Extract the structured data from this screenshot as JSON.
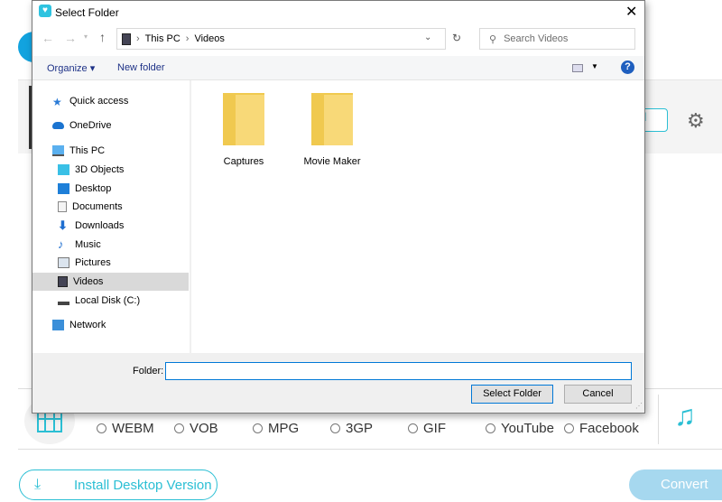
{
  "dialog": {
    "title": "Select Folder",
    "breadcrumb": [
      "This PC",
      "Videos"
    ],
    "search_placeholder": "Search Videos",
    "organize": "Organize",
    "new_folder": "New folder",
    "tree": [
      {
        "label": "Quick access",
        "icon": "star-icon"
      },
      {
        "label": "OneDrive",
        "icon": "cloud-icon"
      },
      {
        "label": "This PC",
        "icon": "monitor-icon"
      },
      {
        "label": "3D Objects",
        "icon": "cube-icon"
      },
      {
        "label": "Desktop",
        "icon": "desktop-icon"
      },
      {
        "label": "Documents",
        "icon": "document-icon"
      },
      {
        "label": "Downloads",
        "icon": "download-arrow-icon"
      },
      {
        "label": "Music",
        "icon": "music-note-icon"
      },
      {
        "label": "Pictures",
        "icon": "picture-icon"
      },
      {
        "label": "Videos",
        "icon": "film-icon",
        "selected": true
      },
      {
        "label": "Local Disk (C:)",
        "icon": "drive-icon"
      },
      {
        "label": "Network",
        "icon": "network-icon"
      }
    ],
    "folders": [
      "Captures",
      "Movie Maker"
    ],
    "folder_label": "Folder:",
    "folder_value": "",
    "select_button": "Select Folder",
    "cancel_button": "Cancel"
  },
  "app": {
    "formats": [
      "WEBM",
      "VOB",
      "MPG",
      "3GP",
      "GIF",
      "YouTube",
      "Facebook"
    ],
    "install_button": "Install Desktop Version",
    "convert_button": "Convert",
    "accent": "#2bbfd4",
    "convert_color": "#a6d8ef"
  }
}
